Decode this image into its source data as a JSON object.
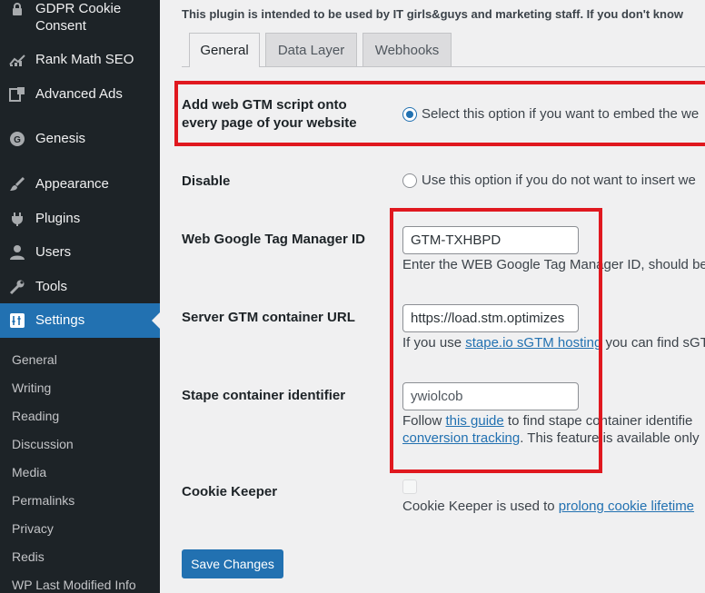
{
  "sidebar": {
    "items": [
      {
        "label": "GDPR Cookie",
        "label2": "Consent",
        "icon": "lock-icon"
      },
      {
        "label": "Rank Math SEO",
        "icon": "chart-icon"
      },
      {
        "label": "Advanced Ads",
        "icon": "ads-icon"
      },
      {
        "label": "Genesis",
        "icon": "genesis-icon"
      },
      {
        "label": "Appearance",
        "icon": "brush-icon"
      },
      {
        "label": "Plugins",
        "icon": "plug-icon"
      },
      {
        "label": "Users",
        "icon": "user-icon"
      },
      {
        "label": "Tools",
        "icon": "wrench-icon"
      },
      {
        "label": "Settings",
        "icon": "settings-icon",
        "current": true
      }
    ],
    "subitems": [
      "General",
      "Writing",
      "Reading",
      "Discussion",
      "Media",
      "Permalinks",
      "Privacy",
      "Redis",
      "WP Last Modified Info"
    ]
  },
  "main": {
    "intro": "This plugin is intended to be used by IT girls&guys and marketing staff. If you don't know",
    "tabs": [
      "General",
      "Data Layer",
      "Webhooks"
    ],
    "active_tab": "General",
    "rows": {
      "add_script_label_1": "Add web GTM script onto",
      "add_script_label_2": "every page of your website",
      "add_script_text": "Select this option if you want to embed the we",
      "disable_label": "Disable",
      "disable_text": "Use this option if you do not want to insert we",
      "gtm_id_label": "Web Google Tag Manager ID",
      "gtm_id_value": "GTM-TXHBPD",
      "gtm_id_desc": "Enter the WEB Google Tag Manager ID, should be",
      "server_url_label": "Server GTM container URL",
      "server_url_value": "https://load.stm.optimizes",
      "server_url_desc_pre": "If you use ",
      "server_url_desc_link": "stape.io sGTM hosting",
      "server_url_desc_post": " you can find sGT",
      "stape_label": "Stape container identifier",
      "stape_value": "ywiolcob",
      "stape_desc_pre": "Follow ",
      "stape_desc_link": "this guide",
      "stape_desc_post": " to find stape container identifie",
      "stape_desc2_link": "conversion tracking",
      "stape_desc2_post": ". This feature is available only",
      "cookie_label": "Cookie Keeper",
      "cookie_desc_pre": "Cookie Keeper is used to ",
      "cookie_desc_link": "prolong cookie lifetime"
    },
    "save_button": "Save Changes"
  },
  "colors": {
    "sidebar_bg": "#1d2327",
    "accent": "#2271b1",
    "highlight": "#e0181f",
    "page_bg": "#f0f0f1"
  }
}
